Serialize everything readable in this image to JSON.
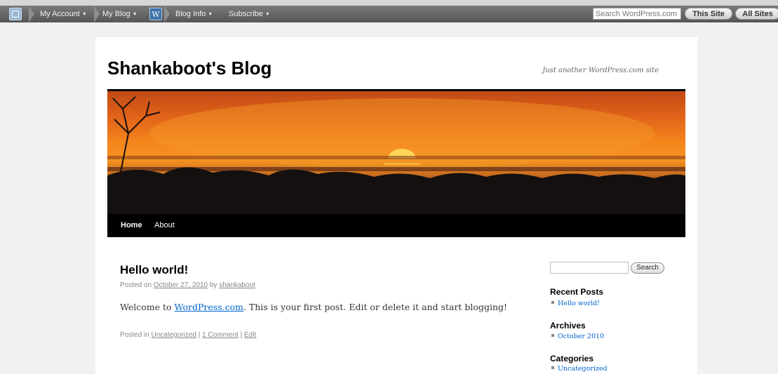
{
  "adminbar": {
    "my_account": "My Account",
    "my_blog": "My Blog",
    "blog_info": "Blog Info",
    "subscribe": "Subscribe",
    "search_placeholder": "Search WordPress.com",
    "this_site": "This Site",
    "all_sites": "All Sites"
  },
  "site": {
    "title": "Shankaboot's Blog",
    "description": "Just another WordPress.com site"
  },
  "nav": {
    "home": "Home",
    "about": "About"
  },
  "post": {
    "title": "Hello world!",
    "meta_prefix": "Posted on",
    "date": "October 27, 2010",
    "meta_by": "by",
    "author": "shankaboot",
    "entry_prefix": "Welcome to",
    "entry_link": "WordPress.com",
    "entry_rest": ". This is your first post. Edit or delete it and start blogging!",
    "posted_in": "Posted in",
    "category": "Uncategorized",
    "sep1": "|",
    "comments": "1 Comment",
    "sep2": "|",
    "edit": "Edit"
  },
  "sidebar": {
    "search_button": "Search",
    "recent_posts_title": "Recent Posts",
    "recent_posts": [
      "Hello world!"
    ],
    "archives_title": "Archives",
    "archives": [
      "October 2010"
    ],
    "categories_title": "Categories",
    "categories": [
      "Uncategorized"
    ]
  },
  "colors": {
    "link": "#0066cc",
    "adminbar": "#5a5a5a"
  }
}
